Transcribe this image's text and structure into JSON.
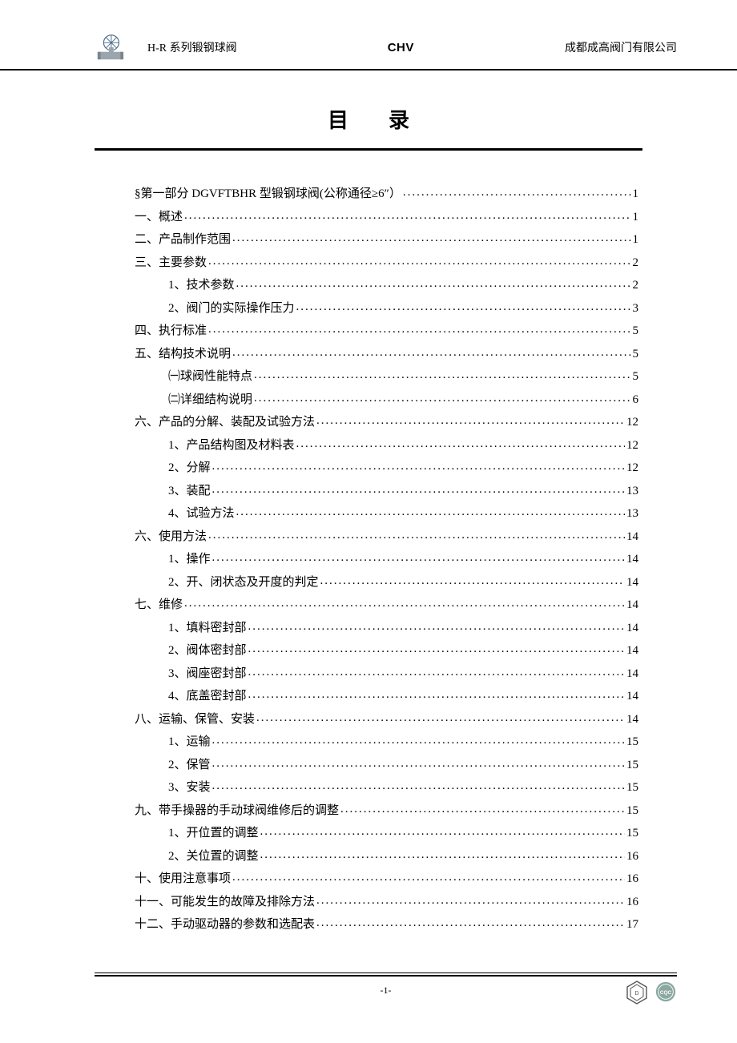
{
  "header": {
    "product_line": "H-R 系列锻钢球阀",
    "brand": "CHV",
    "company": "成都成高阀门有限公司"
  },
  "title": "目录",
  "toc": [
    {
      "level": 0,
      "label": "§第一部分  DGVFTBHR 型锻钢球阀(公称通径≥6″）",
      "page": "1"
    },
    {
      "level": 1,
      "label": "一、概述",
      "page": "1"
    },
    {
      "level": 1,
      "label": "二、产品制作范围",
      "page": "1"
    },
    {
      "level": 1,
      "label": "三、主要参数",
      "page": "2"
    },
    {
      "level": 2,
      "label": "1、技术参数",
      "page": "2"
    },
    {
      "level": 2,
      "label": "2、阀门的实际操作压力",
      "page": "3"
    },
    {
      "level": 1,
      "label": "四、执行标准",
      "page": "5"
    },
    {
      "level": 1,
      "label": "五、结构技术说明",
      "page": "5"
    },
    {
      "level": 2,
      "label": "㈠球阀性能特点",
      "page": "5"
    },
    {
      "level": 2,
      "label": "㈡详细结构说明",
      "page": "6"
    },
    {
      "level": 1,
      "label": "六、产品的分解、装配及试验方法",
      "page": "12"
    },
    {
      "level": 2,
      "label": "1、产品结构图及材料表",
      "page": "12"
    },
    {
      "level": 2,
      "label": "2、分解",
      "page": "12"
    },
    {
      "level": 2,
      "label": "3、装配",
      "page": "13"
    },
    {
      "level": 2,
      "label": "4、试验方法",
      "page": "13"
    },
    {
      "level": 1,
      "label": "六、使用方法",
      "page": "14"
    },
    {
      "level": 2,
      "label": "1、操作",
      "page": "14"
    },
    {
      "level": 2,
      "label": "2、开、闭状态及开度的判定",
      "page": "14"
    },
    {
      "level": 1,
      "label": "七、维修",
      "page": "14"
    },
    {
      "level": 2,
      "label": "1、填料密封部",
      "page": "14"
    },
    {
      "level": 2,
      "label": "2、阀体密封部",
      "page": "14"
    },
    {
      "level": 2,
      "label": "3、阀座密封部",
      "page": "14"
    },
    {
      "level": 2,
      "label": "4、底盖密封部",
      "page": "14"
    },
    {
      "level": 1,
      "label": "八、运输、保管、安装",
      "page": "14"
    },
    {
      "level": 2,
      "label": "1、运输",
      "page": "15"
    },
    {
      "level": 2,
      "label": "2、保管",
      "page": "15"
    },
    {
      "level": 2,
      "label": "3、安装",
      "page": "15"
    },
    {
      "level": 1,
      "label": "九、带手操器的手动球阀维修后的调整",
      "page": "15"
    },
    {
      "level": 2,
      "label": "1、开位置的调整",
      "page": "15"
    },
    {
      "level": 2,
      "label": "2、关位置的调整",
      "page": "16"
    },
    {
      "level": 1,
      "label": "十、使用注意事项",
      "page": "16"
    },
    {
      "level": 1,
      "label": "十一、可能发生的故障及排除方法",
      "page": "16"
    },
    {
      "level": 1,
      "label": "十二、手动驱动器的参数和选配表",
      "page": "17"
    }
  ],
  "footer": {
    "page_number": "-1-"
  },
  "icons": {
    "logo": "valve-handwheel-icon",
    "cert1": "dnv-cert-icon",
    "cert2": "cqc-cert-icon"
  }
}
